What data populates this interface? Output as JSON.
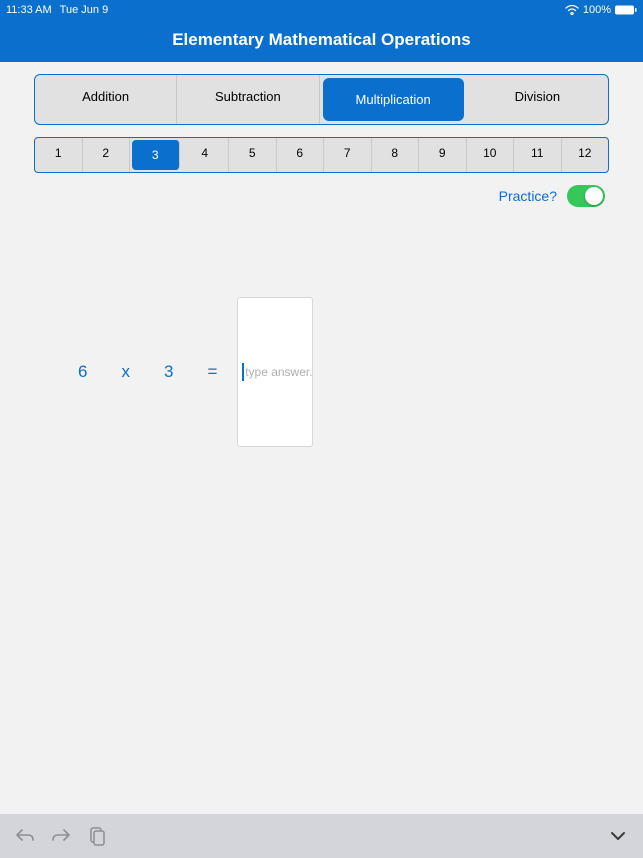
{
  "statusBar": {
    "time": "11:33 AM",
    "date": "Tue Jun 9",
    "battery": "100%"
  },
  "header": {
    "title": "Elementary Mathematical Operations"
  },
  "operations": {
    "items": [
      {
        "label": "Addition",
        "active": false
      },
      {
        "label": "Subtraction",
        "active": false
      },
      {
        "label": "Multiplication",
        "active": true
      },
      {
        "label": "Division",
        "active": false
      }
    ]
  },
  "numbers": {
    "items": [
      {
        "label": "1",
        "active": false
      },
      {
        "label": "2",
        "active": false
      },
      {
        "label": "3",
        "active": true
      },
      {
        "label": "4",
        "active": false
      },
      {
        "label": "5",
        "active": false
      },
      {
        "label": "6",
        "active": false
      },
      {
        "label": "7",
        "active": false
      },
      {
        "label": "8",
        "active": false
      },
      {
        "label": "9",
        "active": false
      },
      {
        "label": "10",
        "active": false
      },
      {
        "label": "11",
        "active": false
      },
      {
        "label": "12",
        "active": false
      }
    ]
  },
  "practice": {
    "label": "Practice?",
    "on": true
  },
  "problem": {
    "operand1": "6",
    "operator": "x",
    "operand2": "3",
    "equals": "=",
    "placeholder": "type answer..."
  }
}
